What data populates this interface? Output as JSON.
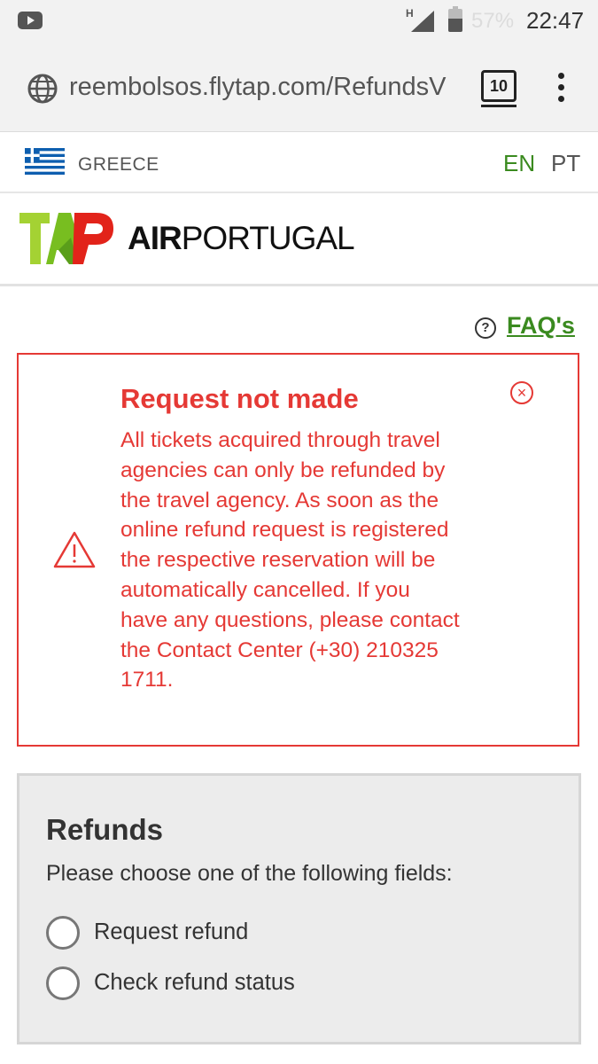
{
  "status_bar": {
    "network": "H",
    "battery": "57%",
    "time": "22:47"
  },
  "browser": {
    "url": "reembolsos.flytap.com/RefundsV",
    "tab_count": "10"
  },
  "country_bar": {
    "country": "GREECE",
    "languages": [
      "EN",
      "PT"
    ],
    "active_language": "EN"
  },
  "header": {
    "logo_text": "TAP",
    "brand_bold": "AIR",
    "brand_regular": "PORTUGAL"
  },
  "faq": {
    "label": "FAQ's"
  },
  "error": {
    "title": "Request not made",
    "message": "All tickets acquired through travel agencies can only be refunded by the travel agency. As soon as the online refund request is registered the respective reservation will be automatically cancelled. If you have any questions, please contact the Contact Center (+30) 210325 1711."
  },
  "refunds": {
    "title": "Refunds",
    "subtitle": "Please choose one of the following fields:",
    "options": [
      {
        "label": "Request refund",
        "selected": false
      },
      {
        "label": "Check refund status",
        "selected": false
      }
    ]
  },
  "colors": {
    "error": "#e53935",
    "accent_green": "#3a8a1f"
  }
}
